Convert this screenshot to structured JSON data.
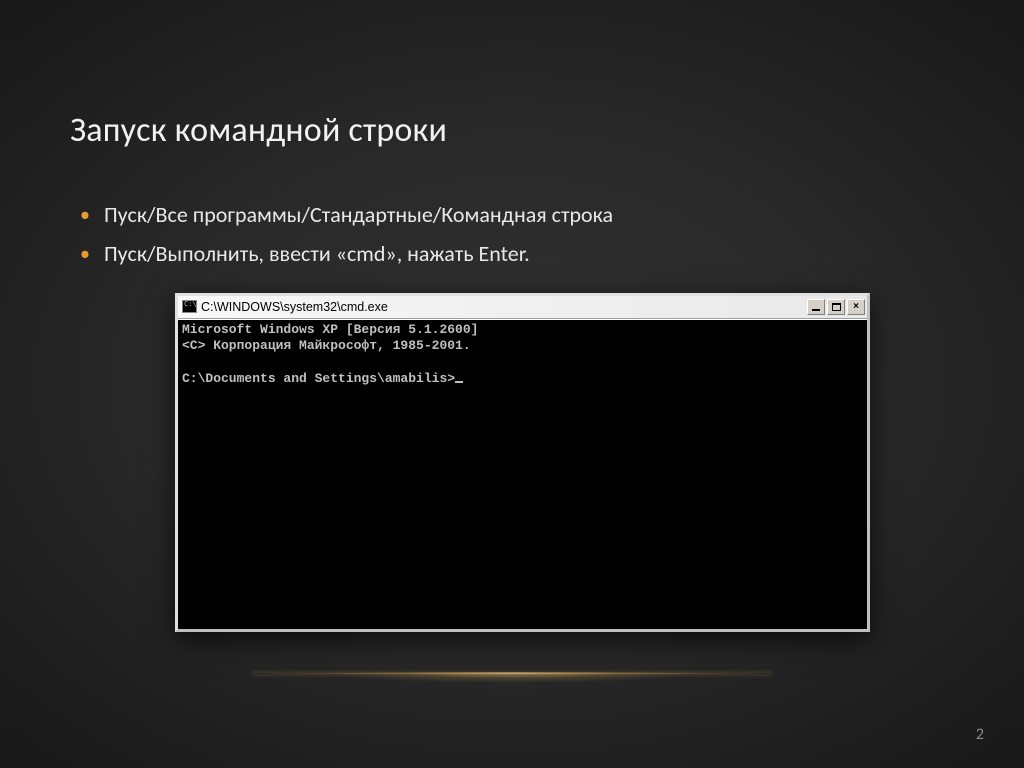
{
  "slide": {
    "title": "Запуск командной строки",
    "bullets": [
      "Пуск/Все программы/Стандартные/Командная строка",
      "Пуск/Выполнить, ввести «cmd», нажать Enter."
    ],
    "page_number": "2"
  },
  "cmd": {
    "window_title": "C:\\WINDOWS\\system32\\cmd.exe",
    "line1": "Microsoft Windows XP [Версия 5.1.2600]",
    "line2": "<C> Корпорация Майкрософт, 1985-2001.",
    "prompt": "C:\\Documents and Settings\\amabilis>"
  }
}
